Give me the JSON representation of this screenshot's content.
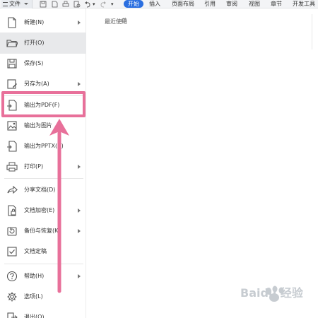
{
  "toolbar": {
    "file_label": "文件",
    "start_label": "开始",
    "tabs": [
      "插入",
      "页面布局",
      "引用",
      "审阅",
      "视图",
      "章节",
      "开发工具"
    ]
  },
  "menu": {
    "items": [
      {
        "label": "新建(N)",
        "icon": "new-doc-icon",
        "has_arrow": true
      },
      {
        "label": "打开(O)",
        "icon": "folder-open-icon",
        "has_arrow": false
      },
      {
        "label": "保存(S)",
        "icon": "save-icon",
        "has_arrow": false
      },
      {
        "label": "另存为(A)",
        "icon": "save-as-icon",
        "has_arrow": true
      },
      {
        "label": "输出为PDF(F)",
        "icon": "export-pdf-icon",
        "has_arrow": false
      },
      {
        "label": "输出为图片",
        "icon": "export-image-icon",
        "has_arrow": false
      },
      {
        "label": "输出为PPTX(X)",
        "icon": "export-pptx-icon",
        "has_arrow": false
      },
      {
        "label": "打印(P)",
        "icon": "printer-icon",
        "has_arrow": true
      },
      {
        "label": "分享文档(D)",
        "icon": "share-icon",
        "has_arrow": false
      },
      {
        "label": "文档加密(E)",
        "icon": "lock-document-icon",
        "has_arrow": true
      },
      {
        "label": "备份与恢复(K)",
        "icon": "backup-icon",
        "has_arrow": true
      },
      {
        "label": "文档定稿",
        "icon": "finalize-icon",
        "has_arrow": false
      },
      {
        "label": "帮助(H)",
        "icon": "help-icon",
        "has_arrow": true
      },
      {
        "label": "选项(L)",
        "icon": "gear-icon",
        "has_arrow": false
      },
      {
        "label": "退出(Q)",
        "icon": "exit-icon",
        "has_arrow": false
      }
    ]
  },
  "recent": {
    "title": "最近使用"
  },
  "watermark": {
    "text": "Baidu 经验"
  },
  "colors": {
    "accent": "#2b6fe0",
    "highlight": "#e8709a",
    "active_bg": "#e8e9eb"
  }
}
